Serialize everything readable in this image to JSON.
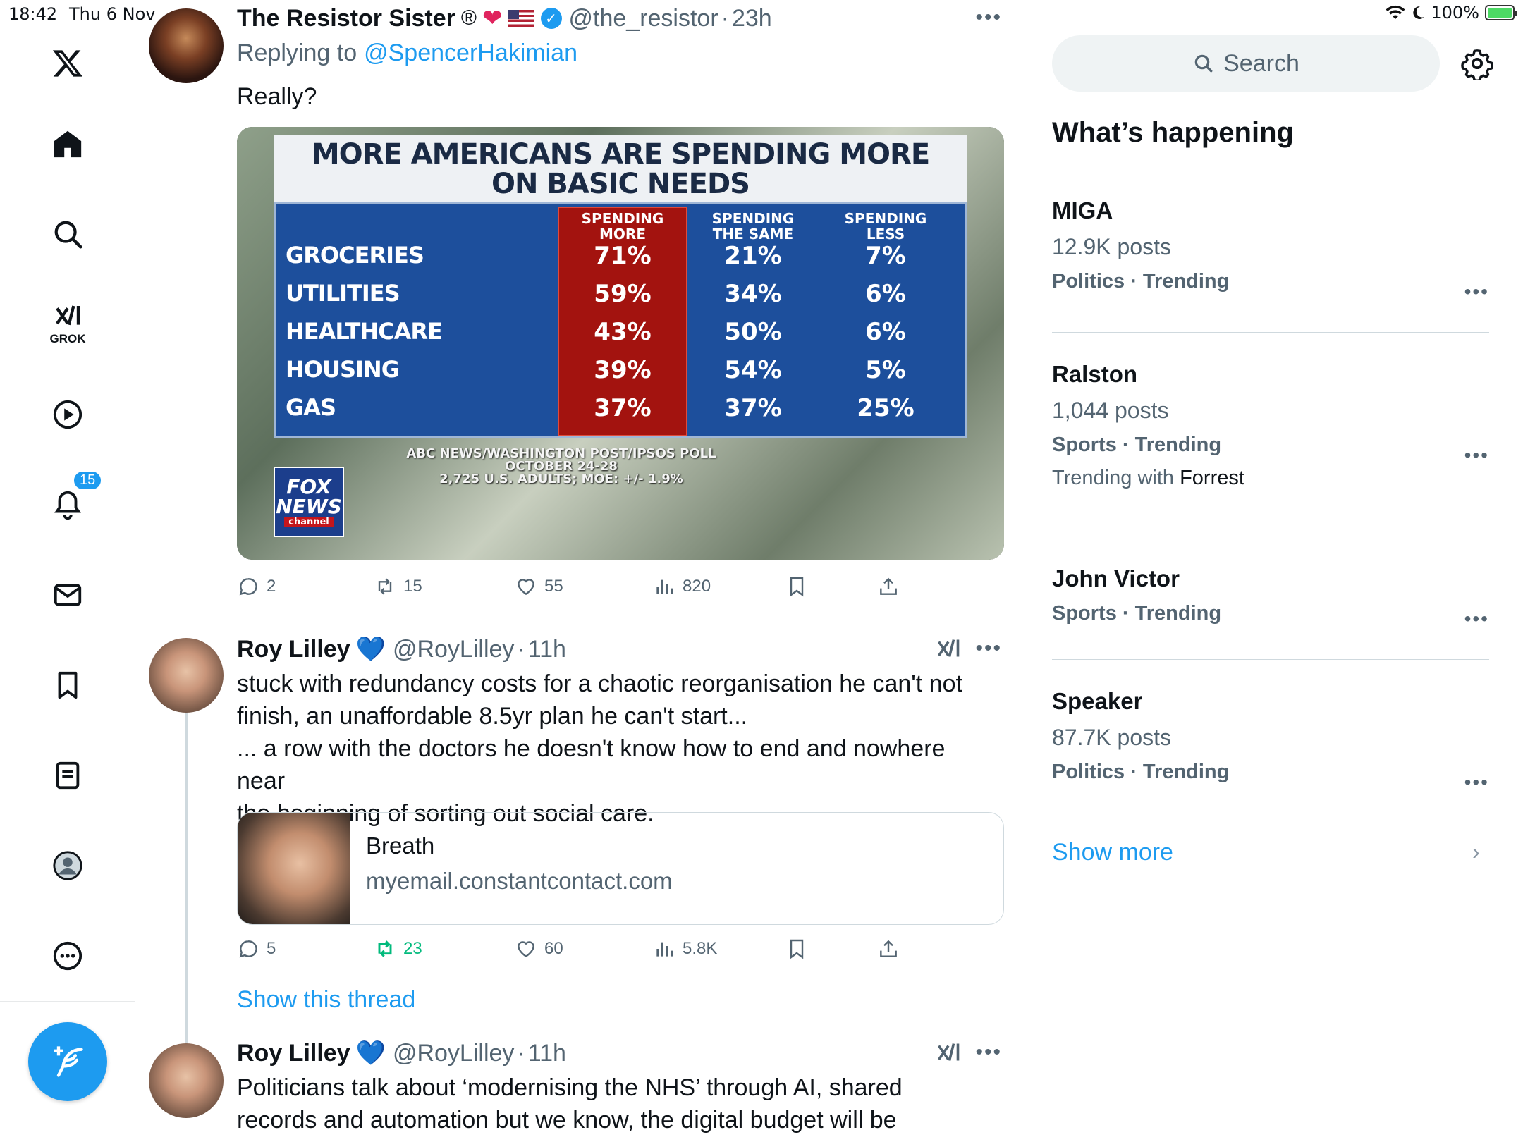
{
  "status": {
    "time": "18:42",
    "date": "Thu 6 Nov",
    "battery": "100%"
  },
  "nav": {
    "grok_label": "GROK",
    "notifications_count": "15"
  },
  "tweets": [
    {
      "name": "The Resistor Sister",
      "handle": "@the_resistor",
      "time": "23h",
      "reply_prefix": "Replying to",
      "reply_to": "@SpencerHakimian",
      "text": "Really?",
      "counts": {
        "replies": "2",
        "reposts": "15",
        "likes": "55",
        "views": "820"
      }
    },
    {
      "name": "Roy Lilley",
      "handle": "@RoyLilley",
      "time": "11h",
      "text_lines": [
        "stuck with redundancy costs for a chaotic reorganisation he can't not",
        "finish, an unaffordable 8.5yr plan he can't start...",
        "... a row with the doctors he doesn't know how to end and nowhere near",
        "the beginning of sorting out social care."
      ],
      "card": {
        "title": "Breath",
        "domain": "myemail.constantcontact.com"
      },
      "counts": {
        "replies": "5",
        "reposts": "23",
        "likes": "60",
        "views": "5.8K"
      },
      "show_thread": "Show this thread"
    },
    {
      "name": "Roy Lilley",
      "handle": "@RoyLilley",
      "time": "11h",
      "text_lines": [
        "Politicians talk about ‘modernising the NHS’ through AI, shared",
        "records and automation but we know, the digital budget will be"
      ]
    }
  ],
  "graphic": {
    "title_line1": "MORE AMERICANS ARE SPENDING MORE",
    "title_line2": "ON BASIC NEEDS",
    "columns": [
      "SPENDING MORE",
      "SPENDING THE SAME",
      "SPENDING LESS"
    ],
    "rows": [
      {
        "label": "GROCERIES",
        "more": "71%",
        "same": "21%",
        "less": "7%"
      },
      {
        "label": "UTILITIES",
        "more": "59%",
        "same": "34%",
        "less": "6%"
      },
      {
        "label": "HEALTHCARE",
        "more": "43%",
        "same": "50%",
        "less": "6%"
      },
      {
        "label": "HOUSING",
        "more": "39%",
        "same": "54%",
        "less": "5%"
      },
      {
        "label": "GAS",
        "more": "37%",
        "same": "37%",
        "less": "25%"
      }
    ],
    "source_line1": "ABC NEWS/WASHINGTON POST/IPSOS POLL",
    "source_line2": "OCTOBER 24-28",
    "source_line3": "2,725 U.S. ADULTS; MOE: +/- 1.9%",
    "logo_line1": "FOX",
    "logo_line2": "NEWS",
    "logo_line3": "channel"
  },
  "sidebar": {
    "search_placeholder": "Search",
    "heading": "What’s happening",
    "trends": [
      {
        "title": "MIGA",
        "posts": "12.9K posts",
        "category": "Politics · Trending"
      },
      {
        "title": "Ralston",
        "posts": "1,044 posts",
        "category": "Sports · Trending",
        "with_prefix": "Trending with",
        "with_name": "Forrest"
      },
      {
        "title": "John Victor",
        "category": "Sports · Trending"
      },
      {
        "title": "Speaker",
        "posts": "87.7K posts",
        "category": "Politics · Trending"
      }
    ],
    "show_more": "Show more"
  },
  "colors": {
    "accent": "#1d9bf0",
    "repost_active": "#00ba7c",
    "secondary_text": "#536471"
  }
}
